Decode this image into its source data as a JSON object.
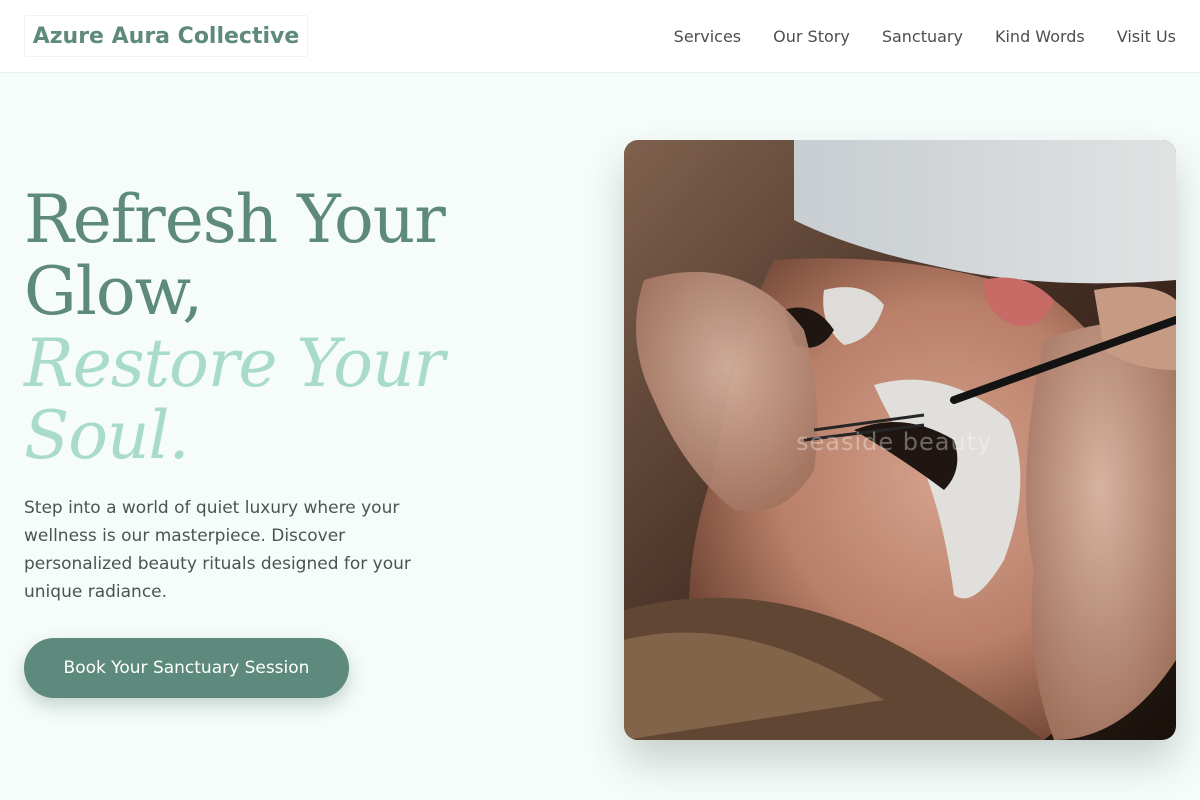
{
  "brand": {
    "name": "Azure Aura Collective"
  },
  "nav": {
    "items": [
      "Services",
      "Our Story",
      "Sanctuary",
      "Kind Words",
      "Visit Us"
    ]
  },
  "hero": {
    "title_line1": "Refresh Your",
    "title_line2": "Glow,",
    "title_accent_line1": "Restore Your",
    "title_accent_line2": "Soul.",
    "description": "Step into a world of quiet luxury where your wellness is our masterpiece. Discover personalized beauty rituals designed for your unique radiance.",
    "cta_label": "Book Your Sanctuary Session",
    "image_watermark": "seaside beauty",
    "image_subject": "lash-extension-treatment-photo"
  },
  "colors": {
    "brand_green": "#5d8a7c",
    "accent_mint": "#a8dcc8",
    "page_bg": "#f6fcf9",
    "header_bg": "#ffffff"
  }
}
